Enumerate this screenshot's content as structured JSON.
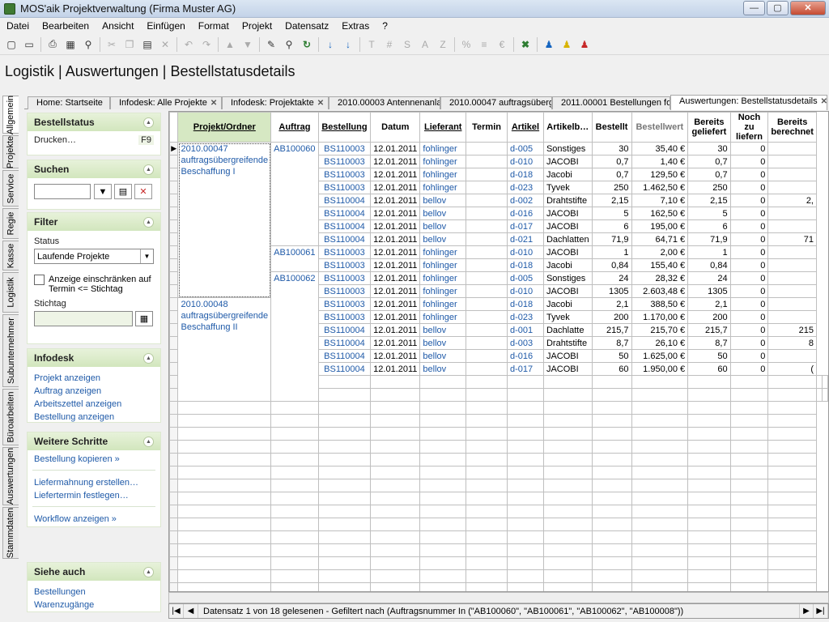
{
  "window": {
    "title": "MOS'aik Projektverwaltung (Firma Muster AG)",
    "minimize": "—",
    "maximize": "▢",
    "close": "✕"
  },
  "menu": [
    "Datei",
    "Bearbeiten",
    "Ansicht",
    "Einfügen",
    "Format",
    "Projekt",
    "Datensatz",
    "Extras",
    "?"
  ],
  "toolbar": [
    {
      "icon": "new-file-icon",
      "g": "▢",
      "s": "",
      "sep": false
    },
    {
      "icon": "open-folder-icon",
      "g": "▭",
      "s": "",
      "sep": true
    },
    {
      "icon": "print-icon",
      "g": "⎙",
      "s": "",
      "sep": false
    },
    {
      "icon": "preview-icon",
      "g": "▦",
      "s": "",
      "sep": false
    },
    {
      "icon": "search-replace-icon",
      "g": "⚲",
      "s": "",
      "sep": true
    },
    {
      "icon": "cut-icon",
      "g": "✂",
      "s": "dis",
      "sep": false
    },
    {
      "icon": "copy-icon",
      "g": "❐",
      "s": "dis",
      "sep": false
    },
    {
      "icon": "paste-icon",
      "g": "▤",
      "s": "",
      "sep": false
    },
    {
      "icon": "delete-icon",
      "g": "✕",
      "s": "dis",
      "sep": true
    },
    {
      "icon": "undo-icon",
      "g": "↶",
      "s": "dis",
      "sep": false
    },
    {
      "icon": "redo-icon",
      "g": "↷",
      "s": "dis",
      "sep": true
    },
    {
      "icon": "move-up-icon",
      "g": "▲",
      "s": "dis",
      "sep": false
    },
    {
      "icon": "move-down-icon",
      "g": "▼",
      "s": "dis",
      "sep": true
    },
    {
      "icon": "pencil-icon",
      "g": "✎",
      "s": "",
      "sep": false
    },
    {
      "icon": "find-icon",
      "g": "⚲",
      "s": "",
      "sep": false
    },
    {
      "icon": "refresh-icon",
      "g": "↻",
      "s": "green",
      "sep": true
    },
    {
      "icon": "sort-ascending-icon",
      "g": "↓",
      "s": "blue",
      "sep": false
    },
    {
      "icon": "sort-descending-icon",
      "g": "↓",
      "s": "blue",
      "sep": true
    },
    {
      "icon": "text-format-icon",
      "g": "T",
      "s": "dis",
      "sep": false
    },
    {
      "icon": "number-format-icon",
      "g": "#",
      "s": "dis",
      "sep": false
    },
    {
      "icon": "sum-icon",
      "g": "S",
      "s": "dis",
      "sep": false
    },
    {
      "icon": "average-icon",
      "g": "A",
      "s": "dis",
      "sep": false
    },
    {
      "icon": "count-icon",
      "g": "Z",
      "s": "dis",
      "sep": true
    },
    {
      "icon": "percent-icon",
      "g": "%",
      "s": "dis",
      "sep": false
    },
    {
      "icon": "outline-icon",
      "g": "≡",
      "s": "dis",
      "sep": false
    },
    {
      "icon": "currency-icon",
      "g": "€",
      "s": "dis",
      "sep": true
    },
    {
      "icon": "excel-export-icon",
      "g": "✖",
      "s": "green",
      "sep": true
    },
    {
      "icon": "user-blue-icon",
      "g": "♟",
      "s": "blue",
      "sep": false
    },
    {
      "icon": "user-yellow-icon",
      "g": "♟",
      "s": "yel",
      "sep": false
    },
    {
      "icon": "user-red-icon",
      "g": "♟",
      "s": "red",
      "sep": false
    }
  ],
  "page_title": "Logistik | Auswertungen | Bestellstatusdetails",
  "vertical_tabs": [
    "Allgemein",
    "Projekte",
    "Service",
    "Regie",
    "Kasse",
    "Logistik",
    "Subunternehmer",
    "Büroarbeiten",
    "Auswertungen",
    "Stammdaten"
  ],
  "doc_tabs": [
    {
      "label": "Home: Startseite",
      "close": ""
    },
    {
      "label": "Infodesk: Alle Projekte",
      "close": "✕"
    },
    {
      "label": "Infodesk: Projektakte",
      "close": "✕"
    },
    {
      "label": "2010.00003 Antennenanla",
      "close": ""
    },
    {
      "label": "2010.00047 auftragsübergr",
      "close": ""
    },
    {
      "label": "2011.00001 Bestellungen fo",
      "close": ""
    },
    {
      "label": "Auswertungen: Bestellstatusdetails",
      "close": "✕"
    }
  ],
  "sidebar": {
    "bestellstatus": {
      "title": "Bestellstatus",
      "print": "Drucken…",
      "print_key": "F9"
    },
    "suchen": {
      "title": "Suchen",
      "value": ""
    },
    "filter": {
      "title": "Filter",
      "status_label": "Status",
      "status_value": "Laufende Projekte",
      "checkbox_label": "Anzeige einschränken auf Termin <= Stichtag",
      "stichtag_label": "Stichtag",
      "stichtag_value": ""
    },
    "infodesk": {
      "title": "Infodesk",
      "links": [
        "Projekt anzeigen",
        "Auftrag anzeigen",
        "Arbeitszettel anzeigen",
        "Bestellung anzeigen"
      ]
    },
    "weitere": {
      "title": "Weitere Schritte",
      "link1": "Bestellung kopieren »",
      "link2": "Liefermahnung erstellen…",
      "link3": "Liefertermin festlegen…",
      "link4": "Workflow anzeigen »"
    },
    "siehe": {
      "title": "Siehe auch",
      "links": [
        "Bestellungen",
        "Warenzugänge"
      ]
    }
  },
  "grid": {
    "columns": [
      "Projekt/Ordner",
      "Auftrag",
      "Bestellung",
      "Datum",
      "Lieferant",
      "Termin",
      "Artikel",
      "Artikelb…",
      "Bestellt",
      "Bestellwert",
      "Bereits geliefert",
      "Noch zu liefern",
      "Bereits berechnet"
    ],
    "projects": [
      {
        "name": "2010.00047 auftragsübergreifende Beschaffung I",
        "rows": 12
      },
      {
        "name": "2010.00048 auftragsübergreifende Beschaffung II",
        "rows": 8
      }
    ],
    "orders": [
      {
        "name": "AB100060",
        "rows": 8
      },
      {
        "name": "AB100061",
        "rows": 2
      },
      {
        "name": "AB100062",
        "rows": 10
      }
    ],
    "rows": [
      [
        "BS110003",
        "12.01.2011",
        "fohlinger",
        "",
        "d-005",
        "Sonstiges",
        "30",
        "35,40 €",
        "30",
        "0",
        ""
      ],
      [
        "BS110003",
        "12.01.2011",
        "fohlinger",
        "",
        "d-010",
        "JACOBI",
        "0,7",
        "1,40 €",
        "0,7",
        "0",
        ""
      ],
      [
        "BS110003",
        "12.01.2011",
        "fohlinger",
        "",
        "d-018",
        "Jacobi",
        "0,7",
        "129,50 €",
        "0,7",
        "0",
        ""
      ],
      [
        "BS110003",
        "12.01.2011",
        "fohlinger",
        "",
        "d-023",
        "Tyvek",
        "250",
        "1.462,50 €",
        "250",
        "0",
        ""
      ],
      [
        "BS110004",
        "12.01.2011",
        "bellov",
        "",
        "d-002",
        "Drahtstifte",
        "2,15",
        "7,10 €",
        "2,15",
        "0",
        "2,"
      ],
      [
        "BS110004",
        "12.01.2011",
        "bellov",
        "",
        "d-016",
        "JACOBI",
        "5",
        "162,50 €",
        "5",
        "0",
        ""
      ],
      [
        "BS110004",
        "12.01.2011",
        "bellov",
        "",
        "d-017",
        "JACOBI",
        "6",
        "195,00 €",
        "6",
        "0",
        ""
      ],
      [
        "BS110004",
        "12.01.2011",
        "bellov",
        "",
        "d-021",
        "Dachlatten",
        "71,9",
        "64,71 €",
        "71,9",
        "0",
        "71"
      ],
      [
        "BS110003",
        "12.01.2011",
        "fohlinger",
        "",
        "d-010",
        "JACOBI",
        "1",
        "2,00 €",
        "1",
        "0",
        ""
      ],
      [
        "BS110003",
        "12.01.2011",
        "fohlinger",
        "",
        "d-018",
        "Jacobi",
        "0,84",
        "155,40 €",
        "0,84",
        "0",
        ""
      ],
      [
        "BS110003",
        "12.01.2011",
        "fohlinger",
        "",
        "d-005",
        "Sonstiges",
        "24",
        "28,32 €",
        "24",
        "0",
        ""
      ],
      [
        "BS110003",
        "12.01.2011",
        "fohlinger",
        "",
        "d-010",
        "JACOBI",
        "1305",
        "2.603,48 €",
        "1305",
        "0",
        ""
      ],
      [
        "BS110003",
        "12.01.2011",
        "fohlinger",
        "",
        "d-018",
        "Jacobi",
        "2,1",
        "388,50 €",
        "2,1",
        "0",
        ""
      ],
      [
        "BS110003",
        "12.01.2011",
        "fohlinger",
        "",
        "d-023",
        "Tyvek",
        "200",
        "1.170,00 €",
        "200",
        "0",
        ""
      ],
      [
        "BS110004",
        "12.01.2011",
        "bellov",
        "",
        "d-001",
        "Dachlatte",
        "215,7",
        "215,70 €",
        "215,7",
        "0",
        "215"
      ],
      [
        "BS110004",
        "12.01.2011",
        "bellov",
        "",
        "d-003",
        "Drahtstifte",
        "8,7",
        "26,10 €",
        "8,7",
        "0",
        "8"
      ],
      [
        "BS110004",
        "12.01.2011",
        "bellov",
        "",
        "d-016",
        "JACOBI",
        "50",
        "1.625,00 €",
        "50",
        "0",
        ""
      ],
      [
        "BS110004",
        "12.01.2011",
        "bellov",
        "",
        "d-017",
        "JACOBI",
        "60",
        "1.950,00 €",
        "60",
        "0",
        "("
      ]
    ]
  },
  "statusbar": {
    "text": "Datensatz 1 von 18 gelesenen - Gefiltert nach (Auftragsnummer In (\"AB100060\", \"AB100061\", \"AB100062\", \"AB100008\"))"
  }
}
